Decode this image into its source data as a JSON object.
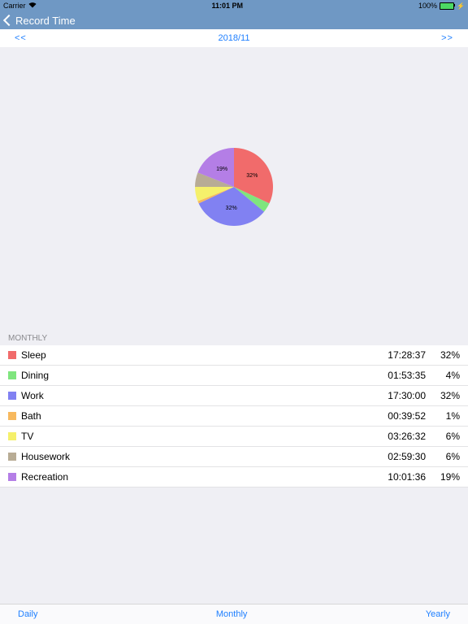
{
  "status": {
    "carrier": "Carrier",
    "time": "11:01 PM",
    "battery": "100%"
  },
  "nav": {
    "back": "Record Time"
  },
  "dateNav": {
    "prev": "<<",
    "title": "2018/11",
    "next": ">>"
  },
  "section": {
    "title": "MONTHLY"
  },
  "rows": [
    {
      "name": "Sleep",
      "time": "17:28:37",
      "pct": "32%",
      "color": "#f16b6b"
    },
    {
      "name": "Dining",
      "time": "01:53:35",
      "pct": "4%",
      "color": "#7fe57e"
    },
    {
      "name": "Work",
      "time": "17:30:00",
      "pct": "32%",
      "color": "#8181f2"
    },
    {
      "name": "Bath",
      "time": "00:39:52",
      "pct": "1%",
      "color": "#f7b95e"
    },
    {
      "name": "TV",
      "time": "03:26:32",
      "pct": "6%",
      "color": "#f5f06b"
    },
    {
      "name": "Housework",
      "time": "02:59:30",
      "pct": "6%",
      "color": "#b8ac95"
    },
    {
      "name": "Recreation",
      "time": "10:01:36",
      "pct": "19%",
      "color": "#b47ee6"
    }
  ],
  "tabs": {
    "daily": "Daily",
    "monthly": "Monthly",
    "yearly": "Yearly"
  },
  "chart_data": {
    "type": "pie",
    "title": "",
    "series": [
      {
        "name": "Sleep",
        "value": 32,
        "color": "#f16b6b",
        "label": "32%"
      },
      {
        "name": "Dining",
        "value": 4,
        "color": "#7fe57e",
        "label": ""
      },
      {
        "name": "Work",
        "value": 32,
        "color": "#8181f2",
        "label": "32%"
      },
      {
        "name": "Bath",
        "value": 1,
        "color": "#f7b95e",
        "label": ""
      },
      {
        "name": "TV",
        "value": 6,
        "color": "#f5f06b",
        "label": ""
      },
      {
        "name": "Housework",
        "value": 6,
        "color": "#b8ac95",
        "label": ""
      },
      {
        "name": "Recreation",
        "value": 19,
        "color": "#b47ee6",
        "label": "19%"
      }
    ]
  }
}
